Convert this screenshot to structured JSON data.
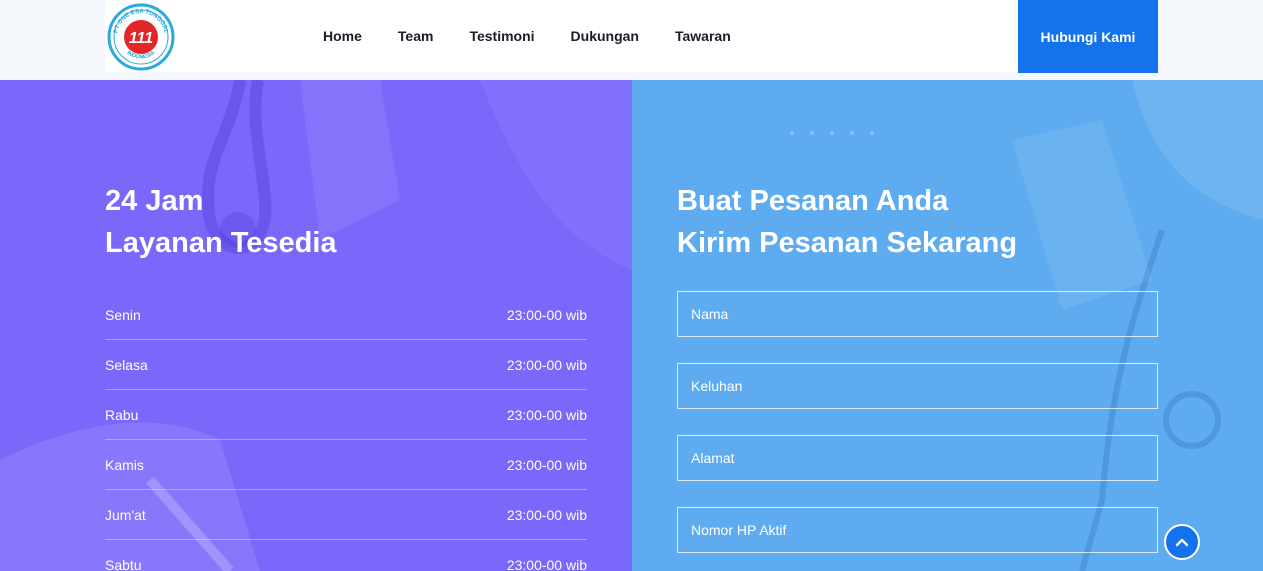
{
  "header": {
    "logo": {
      "ring_text": "PT ONE ESA TUNGGAL",
      "bottom_text": "INDONESIA",
      "mark": "111",
      "colors": {
        "ring": "#2aa9dc",
        "badge": "#e3262a"
      }
    },
    "nav": [
      "Home",
      "Team",
      "Testimoni",
      "Dukungan",
      "Tawaran"
    ],
    "cta_label": "Hubungi Kami"
  },
  "hours": {
    "title_line1": "24 Jam",
    "title_line2": "Layanan Tesedia",
    "rows": [
      {
        "day": "Senin",
        "time": "23:00-00 wib"
      },
      {
        "day": "Selasa",
        "time": "23:00-00 wib"
      },
      {
        "day": "Rabu",
        "time": "23:00-00 wib"
      },
      {
        "day": "Kamis",
        "time": "23:00-00 wib"
      },
      {
        "day": "Jum'at",
        "time": "23:00-00 wib"
      },
      {
        "day": "Sabtu",
        "time": "23:00-00 wib"
      }
    ]
  },
  "order": {
    "title_line1": "Buat Pesanan Anda",
    "title_line2": "Kirim Pesanan Sekarang",
    "fields": [
      {
        "placeholder": "Nama",
        "value": ""
      },
      {
        "placeholder": "Keluhan",
        "value": ""
      },
      {
        "placeholder": "Alamat",
        "value": ""
      },
      {
        "placeholder": "Nomor HP Aktif",
        "value": ""
      }
    ]
  },
  "colors": {
    "accent": "#1472ed",
    "left_panel": "#7a68fb",
    "right_panel": "#5eacef"
  },
  "icons": {
    "scroll_top": "chevron-up-icon"
  }
}
